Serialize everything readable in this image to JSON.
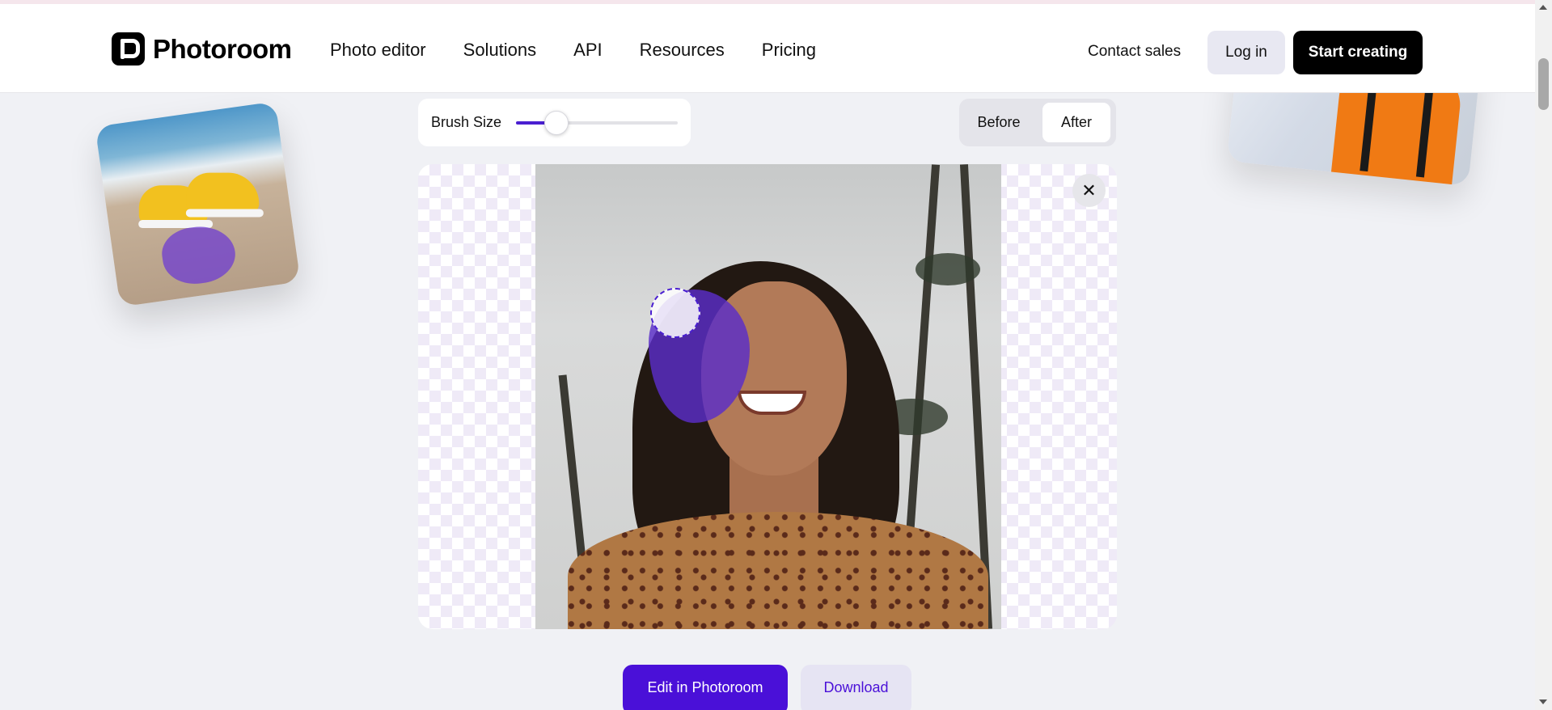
{
  "brand": {
    "name": "Photoroom"
  },
  "nav": {
    "items": [
      "Photo editor",
      "Solutions",
      "API",
      "Resources",
      "Pricing"
    ]
  },
  "header_actions": {
    "contact": "Contact sales",
    "login": "Log in",
    "start": "Start creating"
  },
  "brush": {
    "label": "Brush Size",
    "value_fraction": 0.25
  },
  "view_toggle": {
    "before": "Before",
    "after": "After",
    "selected": "After"
  },
  "canvas": {
    "close_icon": "close-icon",
    "overlay_color": "#5a2dc8"
  },
  "actions": {
    "edit": "Edit in Photoroom",
    "download": "Download"
  },
  "colors": {
    "accent": "#4a10d8",
    "primary_button": "#000000"
  }
}
